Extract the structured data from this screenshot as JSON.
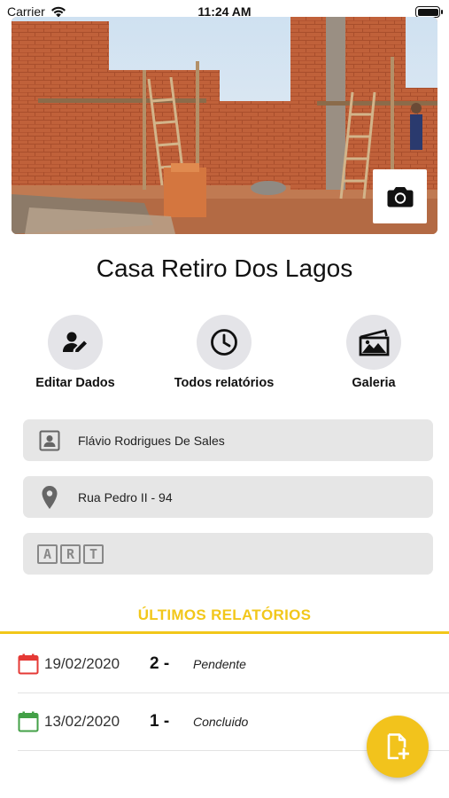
{
  "status_bar": {
    "carrier": "Carrier",
    "time": "11:24 AM"
  },
  "project": {
    "name": "Casa Retiro Dos Lagos"
  },
  "actions": [
    {
      "label": "Editar Dados",
      "icon": "edit-user-icon"
    },
    {
      "label": "Todos relatórios",
      "icon": "clock-icon"
    },
    {
      "label": "Galeria",
      "icon": "gallery-icon"
    }
  ],
  "fields": {
    "owner": "Flávio Rodrigues De Sales",
    "address": "Rua Pedro II - 94",
    "art_letters": [
      "A",
      "R",
      "T"
    ]
  },
  "reports_section": {
    "title": "ÚLTIMOS RELATÓRIOS"
  },
  "reports": [
    {
      "date": "19/02/2020",
      "number": "2 -",
      "status": "Pendente",
      "status_color": "#e53935"
    },
    {
      "date": "13/02/2020",
      "number": "1 -",
      "status": "Concluido",
      "status_color": "#43a047"
    }
  ],
  "colors": {
    "accent": "#f2c71a",
    "fab": "#f2c31c",
    "field_bg": "#e6e6e6",
    "circle_bg": "#e4e4e8"
  }
}
